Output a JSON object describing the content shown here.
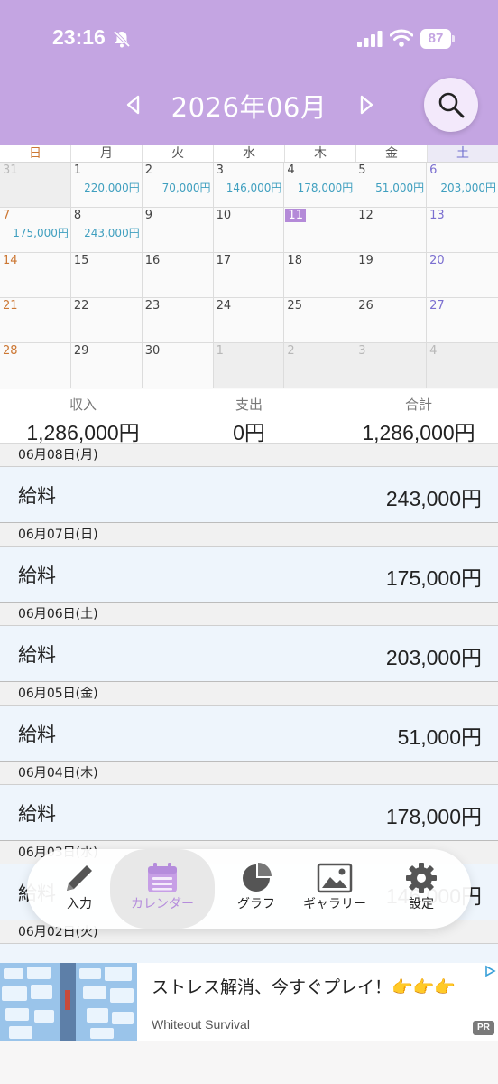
{
  "status_bar": {
    "time": "23:16",
    "battery": "87",
    "icons": [
      "bell-slash-icon",
      "signal-icon",
      "wifi-icon",
      "battery-icon"
    ]
  },
  "header": {
    "month": "2026年06月",
    "prev_icon": "triangle-left-icon",
    "next_icon": "triangle-right-icon",
    "search_icon": "search-icon"
  },
  "calendar": {
    "weekdays": [
      "日",
      "月",
      "火",
      "水",
      "木",
      "金",
      "土"
    ],
    "days": [
      {
        "d": "31",
        "amt": "",
        "out": true
      },
      {
        "d": "1",
        "amt": "220,000円"
      },
      {
        "d": "2",
        "amt": "70,000円"
      },
      {
        "d": "3",
        "amt": "146,000円"
      },
      {
        "d": "4",
        "amt": "178,000円"
      },
      {
        "d": "5",
        "amt": "51,000円"
      },
      {
        "d": "6",
        "amt": "203,000円"
      },
      {
        "d": "7",
        "amt": "175,000円"
      },
      {
        "d": "8",
        "amt": "243,000円"
      },
      {
        "d": "9",
        "amt": ""
      },
      {
        "d": "10",
        "amt": ""
      },
      {
        "d": "11",
        "amt": "",
        "today": true
      },
      {
        "d": "12",
        "amt": ""
      },
      {
        "d": "13",
        "amt": ""
      },
      {
        "d": "14",
        "amt": ""
      },
      {
        "d": "15",
        "amt": ""
      },
      {
        "d": "16",
        "amt": ""
      },
      {
        "d": "17",
        "amt": ""
      },
      {
        "d": "18",
        "amt": ""
      },
      {
        "d": "19",
        "amt": ""
      },
      {
        "d": "20",
        "amt": ""
      },
      {
        "d": "21",
        "amt": ""
      },
      {
        "d": "22",
        "amt": ""
      },
      {
        "d": "23",
        "amt": ""
      },
      {
        "d": "24",
        "amt": ""
      },
      {
        "d": "25",
        "amt": ""
      },
      {
        "d": "26",
        "amt": ""
      },
      {
        "d": "27",
        "amt": ""
      },
      {
        "d": "28",
        "amt": ""
      },
      {
        "d": "29",
        "amt": ""
      },
      {
        "d": "30",
        "amt": ""
      },
      {
        "d": "1",
        "amt": "",
        "out": true
      },
      {
        "d": "2",
        "amt": "",
        "out": true
      },
      {
        "d": "3",
        "amt": "",
        "out": true
      },
      {
        "d": "4",
        "amt": "",
        "out": true
      }
    ]
  },
  "summary": {
    "income_label": "収入",
    "income": "1,286,000円",
    "expense_label": "支出",
    "expense": "0円",
    "total_label": "合計",
    "total": "1,286,000円"
  },
  "entries": [
    {
      "date": "06月08日(月)",
      "category": "給料",
      "amount": "243,000円"
    },
    {
      "date": "06月07日(日)",
      "category": "給料",
      "amount": "175,000円"
    },
    {
      "date": "06月06日(土)",
      "category": "給料",
      "amount": "203,000円"
    },
    {
      "date": "06月05日(金)",
      "category": "給料",
      "amount": "51,000円"
    },
    {
      "date": "06月04日(木)",
      "category": "給料",
      "amount": "178,000円"
    },
    {
      "date": "06月03日(水)",
      "category": "給料",
      "amount": "146,000円"
    },
    {
      "date": "06月02日(火)",
      "category": "",
      "amount": ""
    }
  ],
  "tabs": [
    {
      "label": "入力",
      "icon": "pencil-icon"
    },
    {
      "label": "カレンダー",
      "icon": "calendar-icon",
      "active": true
    },
    {
      "label": "グラフ",
      "icon": "pie-chart-icon"
    },
    {
      "label": "ギャラリー",
      "icon": "image-icon"
    },
    {
      "label": "設定",
      "icon": "gear-icon"
    }
  ],
  "ad": {
    "title": "ストレス解消、今すぐプレイ！👉👉👉",
    "advertiser": "Whiteout Survival",
    "badge": "PR"
  },
  "colors": {
    "header": "#c4a5e2",
    "accent": "#b58cdc",
    "amount": "#3f9fbf",
    "entry_bg": "#eef5fc"
  }
}
